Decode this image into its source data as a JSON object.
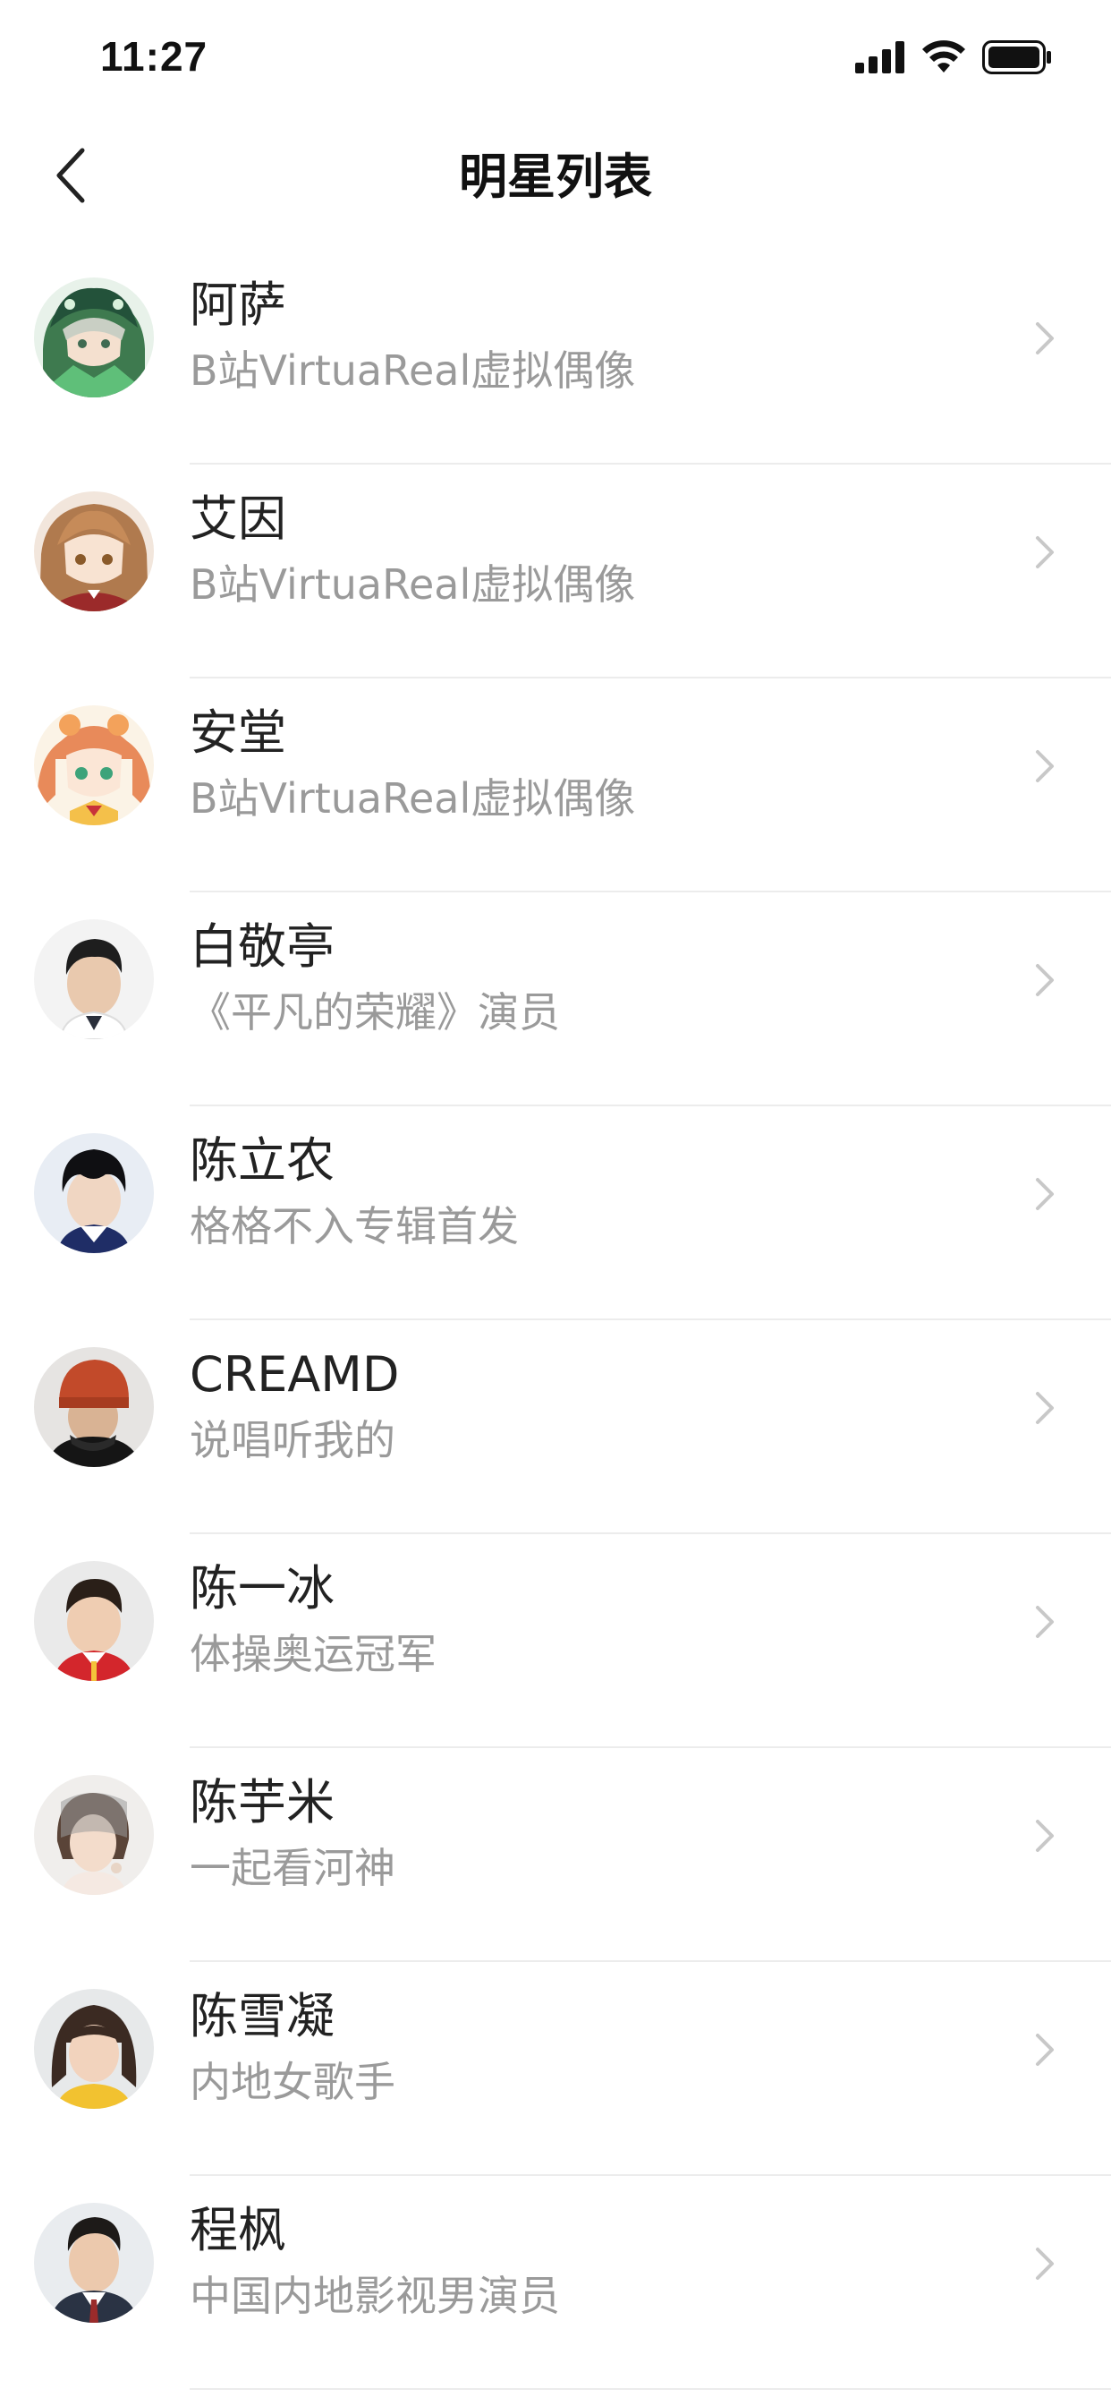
{
  "status_bar": {
    "time": "11:27",
    "icons": [
      "cellular-signal-icon",
      "wifi-icon",
      "battery-icon"
    ]
  },
  "nav": {
    "title": "明星列表",
    "back_icon": "chevron-left-icon"
  },
  "colors": {
    "name": "#222222",
    "desc": "#9a9a9a",
    "divider": "#ececec",
    "chevron": "#c8c8c8"
  },
  "items": [
    {
      "name": "阿萨",
      "desc": "B站VirtuaReal虚拟偶像"
    },
    {
      "name": "艾因",
      "desc": "B站VirtuaReal虚拟偶像"
    },
    {
      "name": "安堂",
      "desc": "B站VirtuaReal虚拟偶像"
    },
    {
      "name": "白敬亭",
      "desc": "《平凡的荣耀》演员"
    },
    {
      "name": "陈立农",
      "desc": "格格不入专辑首发"
    },
    {
      "name": "CREAMD",
      "desc": "说唱听我的"
    },
    {
      "name": "陈一冰",
      "desc": "体操奥运冠军"
    },
    {
      "name": "陈芋米",
      "desc": "一起看河神"
    },
    {
      "name": "陈雪凝",
      "desc": "内地女歌手"
    },
    {
      "name": "程枫",
      "desc": "中国内地影视男演员"
    }
  ]
}
